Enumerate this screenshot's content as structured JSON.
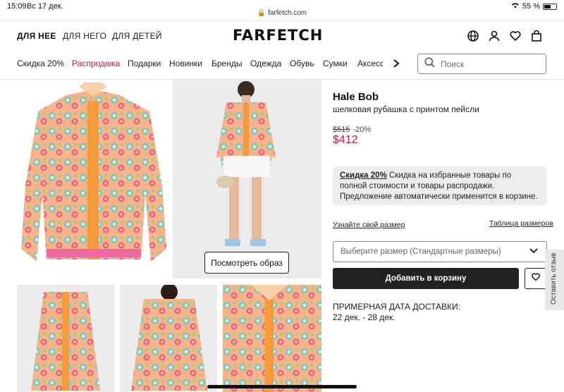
{
  "status": {
    "time": "15:09",
    "date": "Вс 17 дек.",
    "battery": "55 %",
    "url": "farfetch.com"
  },
  "header": {
    "genders": [
      "ДЛЯ НЕЕ",
      "ДЛЯ НЕГО",
      "ДЛЯ ДЕТЕЙ"
    ],
    "logo": "FARFETCH",
    "icons": [
      "globe-icon",
      "user-icon",
      "heart-icon",
      "bag-icon"
    ]
  },
  "nav": {
    "items": [
      "Скидка 20%",
      "Распродажа",
      "Подарки",
      "Новинки",
      "Бренды",
      "Одежда",
      "Обувь",
      "Сумки",
      "Аксессуары"
    ],
    "sale_color": "#d2153b",
    "search_placeholder": "Поиск"
  },
  "gallery": {
    "view_look_label": "Посмотреть образ"
  },
  "product": {
    "brand": "Hale Bob",
    "name": "шелковая рубашка с принтом пейсли",
    "old_price": "$515",
    "discount": "-20%",
    "price": "$412",
    "promo_bold": "Скидка 20%",
    "promo_text": " Скидка на избранные товары по полной стоимости и товары распродажи. Предложение автоматически применится в корзине.",
    "size_link": "Узнайте свой размер",
    "size_table_link": "Таблица размеров",
    "size_select": "Выберите размер (Стандартные размеры)",
    "add_to_cart": "Добавить в корзину",
    "delivery_title": "ПРИМЕРНАЯ ДАТА ДОСТАВКИ:",
    "delivery_dates": "22 дек. - 28 дек."
  },
  "feedback_label": "Оставить отзыв"
}
